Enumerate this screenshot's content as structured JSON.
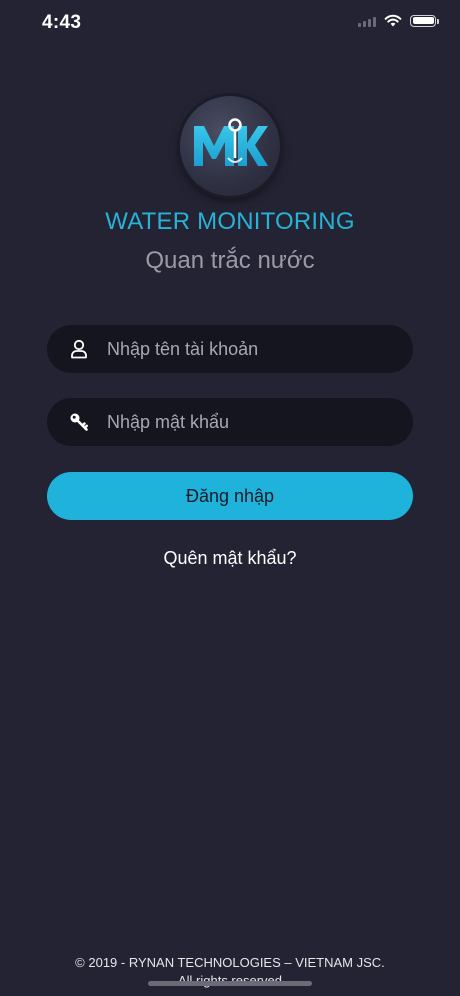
{
  "status_bar": {
    "time": "4:43"
  },
  "app": {
    "logo_icon": "mk-water-logo-icon",
    "title": "WATER MONITORING",
    "subtitle": "Quan trắc nước"
  },
  "login_form": {
    "username": {
      "icon": "user-icon",
      "placeholder": "Nhập tên tài khoản",
      "value": ""
    },
    "password": {
      "icon": "key-icon",
      "placeholder": "Nhập mật khẩu",
      "value": ""
    },
    "submit_label": "Đăng nhập",
    "forgot_label": "Quên mật khẩu?"
  },
  "footer": {
    "copyright": "© 2019 - RYNAN TECHNOLOGIES – VIETNAM JSC.",
    "rights": "All rights reserved"
  },
  "colors": {
    "background": "#232334",
    "accent": "#1fb3dc",
    "title": "#27b2d6",
    "subtitle": "#9b9ba6",
    "field_bg": "#15151f"
  }
}
